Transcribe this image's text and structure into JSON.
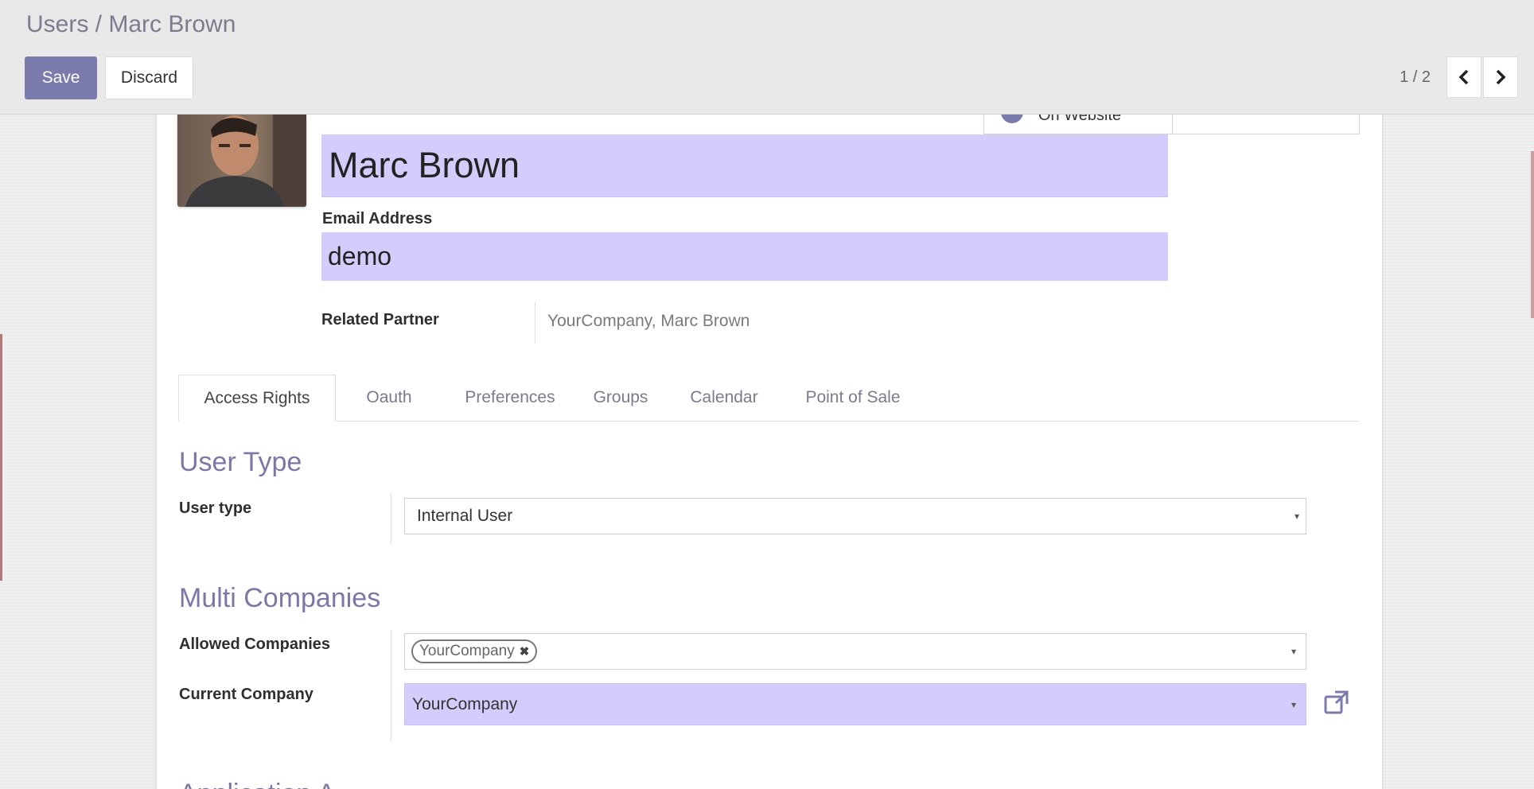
{
  "header": {
    "breadcrumb": "Users / Marc Brown",
    "save_label": "Save",
    "discard_label": "Discard",
    "pager": "1 / 2"
  },
  "stat_buttons": {
    "website_label": "On Website"
  },
  "form": {
    "name": "Marc Brown",
    "email_label": "Email Address",
    "email_value": "demo",
    "partner_label": "Related Partner",
    "partner_value": "YourCompany, Marc Brown"
  },
  "tabs": [
    {
      "label": "Access Rights",
      "active": true
    },
    {
      "label": "Oauth"
    },
    {
      "label": "Preferences"
    },
    {
      "label": "Groups"
    },
    {
      "label": "Calendar"
    },
    {
      "label": "Point of Sale"
    }
  ],
  "user_type_section": {
    "title": "User Type",
    "field_label": "User type",
    "value": "Internal User"
  },
  "multi_companies_section": {
    "title": "Multi Companies",
    "allowed_label": "Allowed Companies",
    "allowed_tags": [
      "YourCompany"
    ],
    "current_label": "Current Company",
    "current_value": "YourCompany"
  },
  "next_section_partial": "Application A",
  "colors": {
    "accent": "#7c7bad",
    "required_field_bg": "#d2cdfa",
    "section_title": "#7b78a8"
  },
  "icons": [
    "chevron-left-icon",
    "chevron-right-icon",
    "globe-icon",
    "external-link-icon",
    "remove-tag-icon",
    "dropdown-caret-icon"
  ]
}
